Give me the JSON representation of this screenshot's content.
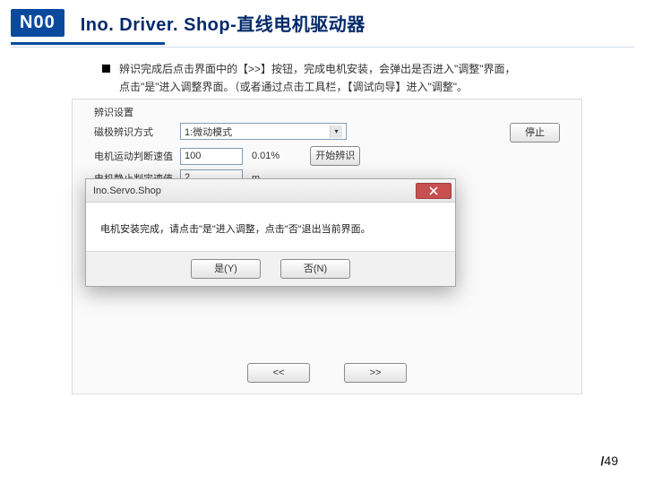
{
  "header": {
    "logo": "N00",
    "title": "Ino. Driver. Shop-直线电机驱动器"
  },
  "bullet": {
    "line1": "辨识完成后点击界面中的【>>】按钮，完成电机安装，会弹出是否进入\"调整\"界面，",
    "line2": "点击\"是\"进入调整界面。（或者通过点击工具栏，【调试向导】进入\"调整\"。"
  },
  "panel": {
    "group_label": "辨识设置",
    "row_mode": {
      "label": "磁极辨识方式",
      "value": "1:微动模式"
    },
    "row_move": {
      "label": "电机运动判断速值",
      "value": "100",
      "unit": "0.01%"
    },
    "row_still": {
      "label": "电机静止判定速值",
      "value": "2",
      "unit": "m"
    },
    "btn_start": "开始辨识",
    "btn_stop": "停止",
    "nav_prev": "<<",
    "nav_next": ">>"
  },
  "dialog": {
    "title": "Ino.Servo.Shop",
    "message": "电机安装完成，请点击\"是\"进入调整，点击\"否\"退出当前界面。",
    "yes": "是(Y)",
    "no": "否(N)"
  },
  "footer": {
    "sep": "/",
    "total": "49"
  }
}
